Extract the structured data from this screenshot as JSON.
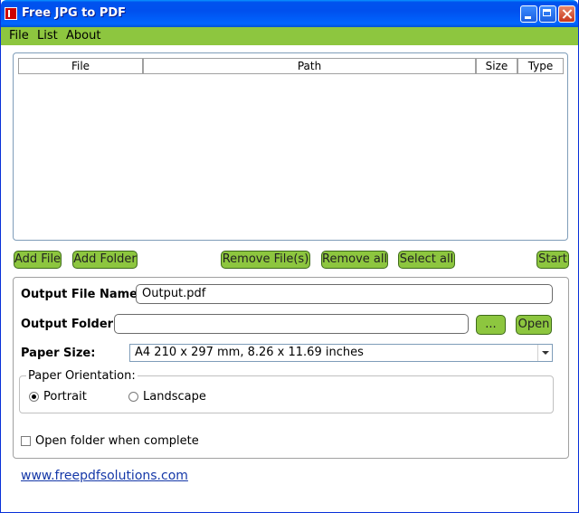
{
  "window": {
    "title": "Free JPG to PDF"
  },
  "menu": [
    "File",
    "List",
    "About"
  ],
  "file_list": {
    "columns": [
      "File",
      "Path",
      "Size",
      "Type"
    ],
    "rows": []
  },
  "buttons": {
    "add_file": "Add File",
    "add_folder": "Add Folder",
    "remove_files": "Remove File(s)",
    "remove_all": "Remove all",
    "select_all": "Select all",
    "start": "Start",
    "browse": "...",
    "open": "Open"
  },
  "output": {
    "file_name_label": "Output File Name:",
    "file_name_value": "Output.pdf",
    "folder_label": "Output Folder:",
    "folder_value": ""
  },
  "paper": {
    "size_label": "Paper Size:",
    "size_value": "A4 210 x 297 mm, 8.26 x 11.69 inches",
    "orientation_label": "Paper Orientation:",
    "portrait": "Portrait",
    "landscape": "Landscape",
    "selected": "Portrait"
  },
  "open_folder_checkbox": {
    "label": "Open folder when complete",
    "checked": false
  },
  "footer_link": "www.freepdfsolutions.com",
  "colors": {
    "accent_green": "#8dc63f",
    "title_blue": "#0053ee",
    "link": "#1538a8"
  }
}
